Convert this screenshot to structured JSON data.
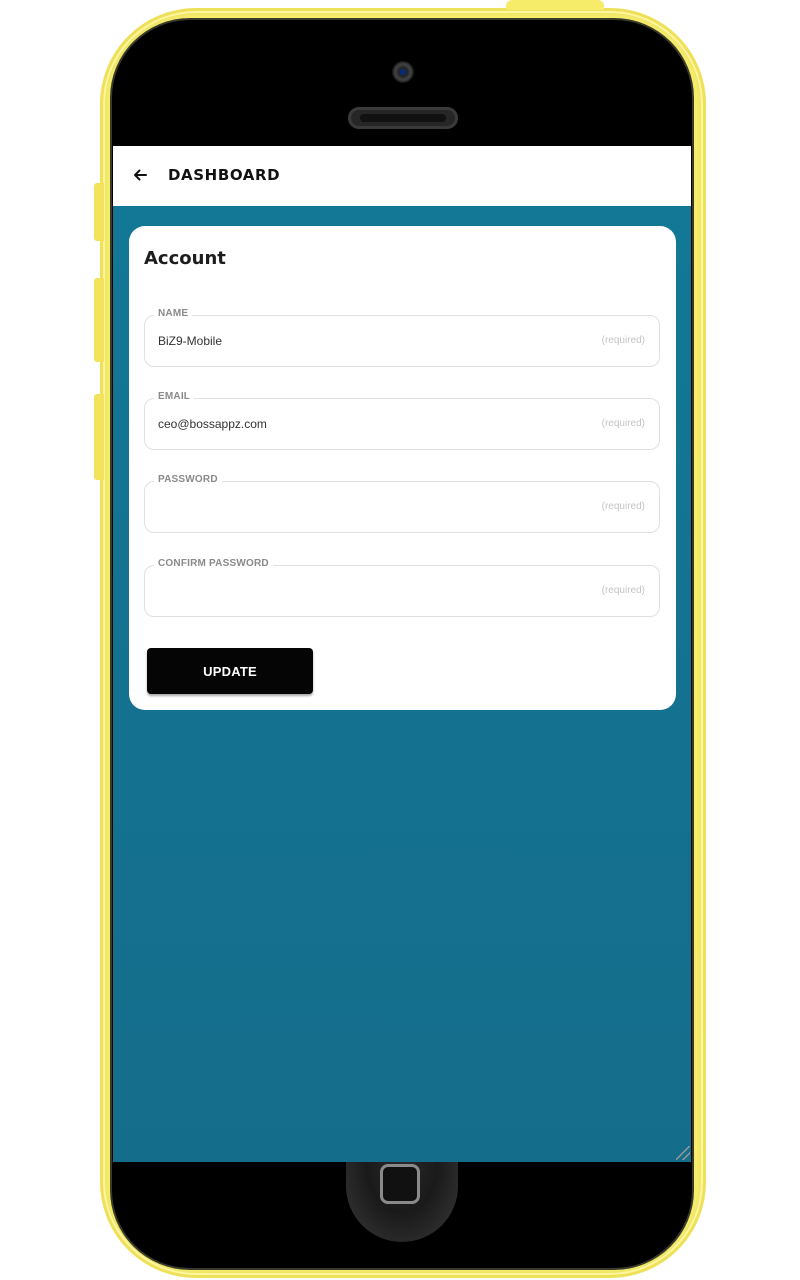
{
  "device": {
    "frame_color": "#f6ec6a",
    "screen_color": "#137897"
  },
  "appbar": {
    "back_icon": "arrow-left-icon",
    "title": "DASHBOARD"
  },
  "card": {
    "title": "Account",
    "fields": [
      {
        "label": "NAME",
        "value": "BiZ9-Mobile",
        "hint": "(required)"
      },
      {
        "label": "EMAIL",
        "value": "ceo@bossappz.com",
        "hint": "(required)"
      },
      {
        "label": "PASSWORD",
        "value": "",
        "hint": "(required)"
      },
      {
        "label": "CONFIRM PASSWORD",
        "value": "",
        "hint": "(required)"
      }
    ],
    "update_label": "UPDATE"
  }
}
